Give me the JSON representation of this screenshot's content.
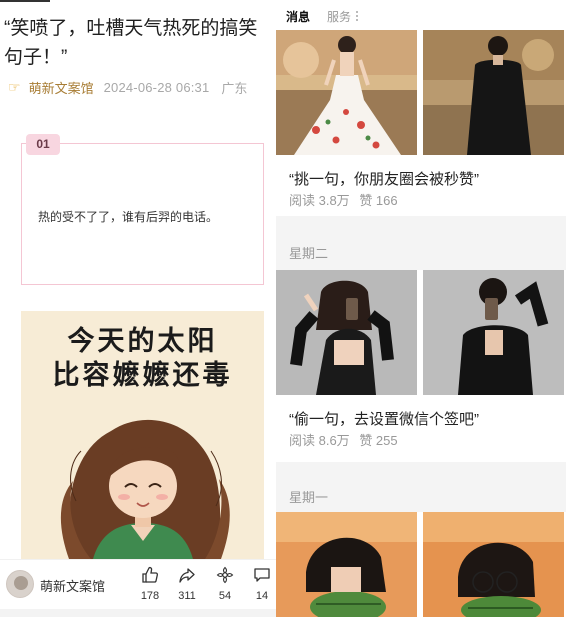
{
  "article": {
    "title": "“笑喷了，吐槽天气热死的搞笑句子！”",
    "author": "萌新文案馆",
    "date": "2024-06-28 06:31",
    "location": "广东",
    "quote_index": "01",
    "quote_text": "热的受不了了，谁有后羿的电话。",
    "poster_line1": "今天的太阳",
    "poster_line2": "比容嬷嬷还毒"
  },
  "bottom_bar": {
    "account_name": "萌新文案馆",
    "likes": "178",
    "shares": "311",
    "favorites": "54",
    "comments": "14"
  },
  "right_panel": {
    "tabs": [
      {
        "label": "消息",
        "active": true
      },
      {
        "label": "服务",
        "active": false
      }
    ],
    "cards": [
      {
        "title": "“挑一句，你朋友圈会被秒赞”",
        "reads": "阅读 3.8万",
        "likes": "赞 166"
      },
      {
        "day": "星期二",
        "title": "“偷一句，去设置微信个签吧”",
        "reads": "阅读 8.6万",
        "likes": "赞 255"
      },
      {
        "day": "星期一"
      }
    ]
  },
  "colors": {
    "author_gold": "#a87d35",
    "box_border_pink": "#f4c6d3",
    "badge_pink": "#f8d6e0",
    "poster_bg": "#f7ecd6",
    "panel_gray": "#f4f4f4"
  },
  "icons": [
    "hand-point-icon",
    "thumbs-up-icon",
    "share-icon",
    "favorite-flower-icon",
    "comment-icon",
    "more-dots-icon"
  ]
}
